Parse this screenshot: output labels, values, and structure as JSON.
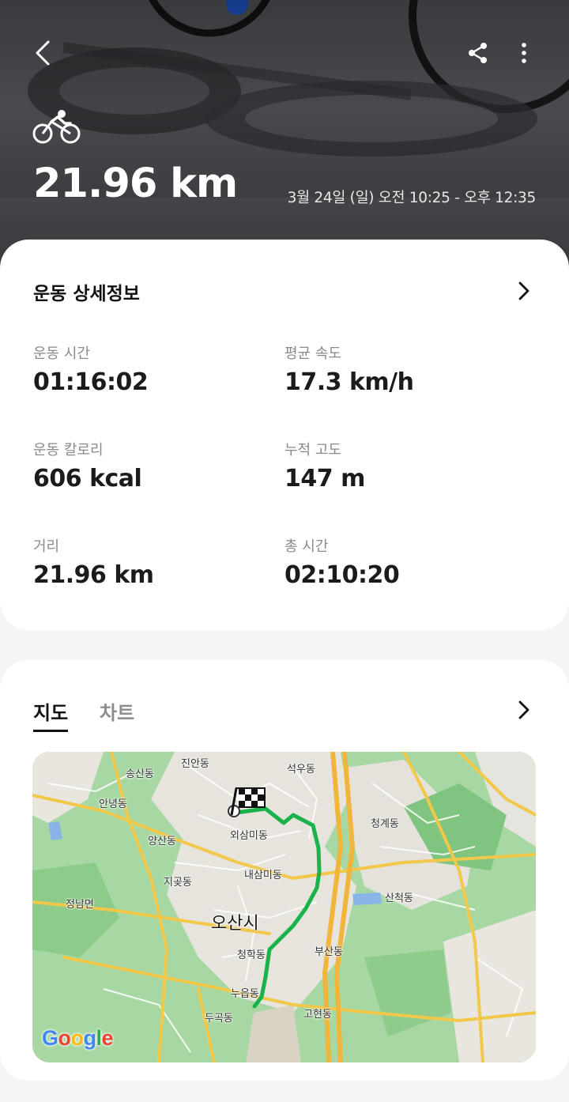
{
  "header": {
    "back_icon": "chevron-left-icon",
    "share_icon": "share-icon",
    "more_icon": "more-vertical-icon",
    "activity_icon": "bicycle-icon",
    "distance": "21.96 km",
    "datetime": "3월 24일 (일) 오전 10:25 - 오후 12:35"
  },
  "details": {
    "title": "운동 상세정보",
    "chevron_icon": "chevron-right-icon",
    "stats": [
      {
        "label": "운동 시간",
        "value": "01:16:02"
      },
      {
        "label": "평균 속도",
        "value": "17.3 km/h"
      },
      {
        "label": "운동 칼로리",
        "value": "606 kcal"
      },
      {
        "label": "누적 고도",
        "value": "147 m"
      },
      {
        "label": "거리",
        "value": "21.96 km"
      },
      {
        "label": "총 시간",
        "value": "02:10:20"
      }
    ]
  },
  "map_section": {
    "tabs": [
      {
        "label": "지도",
        "selected": true
      },
      {
        "label": "차트",
        "selected": false
      }
    ],
    "chevron_icon": "chevron-right-icon",
    "map": {
      "places": [
        "진안동",
        "석우동",
        "송산동",
        "안녕동",
        "청계동",
        "외삼미동",
        "양산동",
        "내삼미동",
        "지곶동",
        "산척동",
        "정남면",
        "오산시",
        "부산동",
        "청학동",
        "누읍동",
        "두곡동",
        "고현동"
      ],
      "finish_icon": "checkered-flag-icon",
      "route_color": "#19b24b",
      "attribution": "Google"
    }
  }
}
